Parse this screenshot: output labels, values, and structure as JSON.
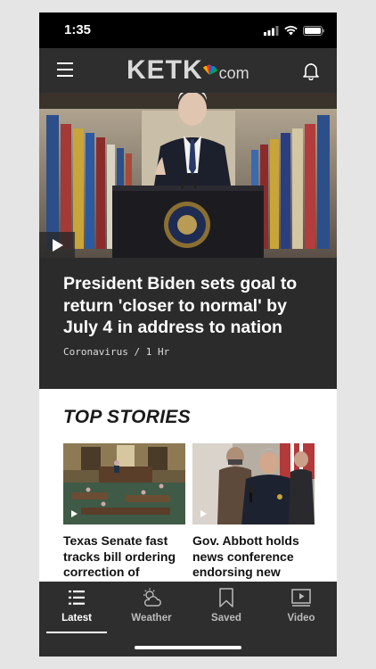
{
  "status_bar": {
    "time": "1:35"
  },
  "app_bar": {
    "logo_text": "KETK",
    "logo_suffix": "com"
  },
  "hero": {
    "headline": "President Biden sets goal to return 'closer to normal' by July 4 in address to nation",
    "meta": "Coronavirus / 1 Hr"
  },
  "top_stories": {
    "title": "TOP STORIES",
    "items": [
      {
        "title": "Texas Senate fast tracks bill ordering correction of"
      },
      {
        "title": "Gov. Abbott holds news conference endorsing new"
      }
    ]
  },
  "tab_bar": {
    "tabs": [
      {
        "label": "Latest",
        "icon": "list-icon",
        "active": true
      },
      {
        "label": "Weather",
        "icon": "weather-icon",
        "active": false
      },
      {
        "label": "Saved",
        "icon": "bookmark-icon",
        "active": false
      },
      {
        "label": "Video",
        "icon": "video-icon",
        "active": false
      }
    ]
  },
  "colors": {
    "bar_bg": "#2e2e2e",
    "hero_bg": "#2b2b2b",
    "content_bg": "#ffffff"
  }
}
